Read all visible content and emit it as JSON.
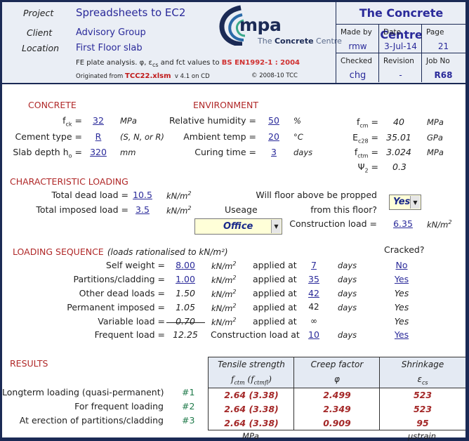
{
  "header": {
    "project_label": "Project",
    "project_value": "Spreadsheets to EC2",
    "client_label": "Client",
    "client_value": "Advisory Group",
    "location_label": "Location",
    "location_value": "First Floor slab",
    "description_prefix": "FE plate analysis. φ, ε",
    "description_sub": "cs",
    "description_mid": " and fct values to ",
    "description_standard": "BS EN1992-1 : 2004",
    "originated_prefix": "Originated from ",
    "originated_file": "TCC22.xlsm",
    "originated_version": "v 4.1 on CD",
    "copyright": "© 2008-10 TCC",
    "logo_text": "mpa",
    "logo_sub_prefix": "The ",
    "logo_sub_bold": "Concrete",
    "logo_sub_suffix": " Centre",
    "org_title": "The Concrete Centre",
    "made_by_label": "Made by",
    "made_by_value": "rmw",
    "date_label": "Date",
    "date_value": "3-Jul-14",
    "page_label": "Page",
    "page_value": "21",
    "checked_label": "Checked",
    "checked_value": "chg",
    "revision_label": "Revision",
    "revision_value": "-",
    "job_no_label": "Job No",
    "job_no_value": "R68"
  },
  "concrete": {
    "title": "CONCRETE",
    "fck_label": "f",
    "fck_sub": "ck",
    "fck_eq": " =",
    "fck_value": "32",
    "fck_unit": "MPa",
    "cement_label": "Cement type =",
    "cement_value": "R",
    "cement_hint": "(S, N, or R)",
    "depth_label": "Slab depth h",
    "depth_sub": "o",
    "depth_eq": " =",
    "depth_value": "320",
    "depth_unit": "mm"
  },
  "environment": {
    "title": "ENVIRONMENT",
    "rh_label": "Relative humidity =",
    "rh_value": "50",
    "rh_unit": "%",
    "temp_label": "Ambient temp =",
    "temp_value": "20",
    "temp_unit": "°C",
    "curing_label": "Curing time =",
    "curing_value": "3",
    "curing_unit": "days"
  },
  "properties": {
    "fcm_label": "f",
    "fcm_sub": "cm",
    "fcm_value": "40",
    "fcm_unit": "MPa",
    "ec28_label": "E",
    "ec28_sub": "c28",
    "ec28_value": "35.01",
    "ec28_unit": "GPa",
    "fctm_label": "f",
    "fctm_sub": "ctm",
    "fctm_value": "3.024",
    "fctm_unit": "MPa",
    "psi2_label": "Ψ",
    "psi2_sub": "2",
    "psi2_value": "0.3",
    "eq": " ="
  },
  "characteristic": {
    "title": "CHARACTERISTIC LOADING",
    "dead_label": "Total dead load =",
    "dead_value": "10.5",
    "imposed_label": "Total imposed load =",
    "imposed_value": "3.5",
    "unit_base": "kN/m",
    "unit_sup": "2",
    "useage_label": "Useage",
    "useage_value": "Office",
    "propped_label_1": "Will floor above be propped",
    "propped_label_2": "from this floor?",
    "propped_value": "Yes",
    "construction_label": "Construction load =",
    "construction_value": "6.35",
    "dropdown_arrow": "▼"
  },
  "sequence": {
    "title": "LOADING SEQUENCE",
    "subtitle": "(loads rationalised to kN/m²)",
    "cracked_header": "Cracked?",
    "applied_at": "applied at",
    "days": "days",
    "unit_base": "kN/m",
    "unit_sup": "2",
    "rows": [
      {
        "label": "Self weight =",
        "value": "8.00",
        "value_input": true,
        "age": "7",
        "age_input": true,
        "days": true,
        "cracked": "No",
        "cracked_input": true
      },
      {
        "label": "Partitions/cladding =",
        "value": "1.00",
        "value_input": true,
        "age": "35",
        "age_input": true,
        "days": true,
        "cracked": "Yes",
        "cracked_input": true
      },
      {
        "label": "Other dead loads =",
        "value": "1.50",
        "value_input": false,
        "age": "42",
        "age_input": true,
        "days": true,
        "cracked": "Yes",
        "cracked_input": false
      },
      {
        "label": "Permanent imposed =",
        "value": "1.05",
        "value_input": false,
        "age": "42",
        "age_input": false,
        "days": true,
        "cracked": "Yes",
        "cracked_input": false
      },
      {
        "label": "Variable load =",
        "value": "0.70",
        "value_input": false,
        "age": "∞",
        "age_input": false,
        "days": false,
        "cracked": "Yes",
        "cracked_input": false
      }
    ],
    "frequent_label": "Frequent load =",
    "frequent_value": "12.25",
    "construction_at_label": "Construction load at",
    "construction_age": "10",
    "construction_cracked": "Yes"
  },
  "results": {
    "title": "RESULTS",
    "col1_title": "Tensile strength",
    "col1_symbol": "f",
    "col1_sub": "ctm",
    "col1_paren": " (f",
    "col1_paren_sub": "ctmfl",
    "col1_paren_close": ")",
    "col2_title": "Creep factor",
    "col2_symbol": "φ",
    "col3_title": "Shrinkage",
    "col3_symbol": "ε",
    "col3_sub": "cs",
    "rows": [
      {
        "label": "Longterm loading (quasi-permanent)",
        "id": "#1",
        "tensile": "2.64 (3.38)",
        "creep": "2.499",
        "shrinkage": "523"
      },
      {
        "label": "For frequent loading",
        "id": "#2",
        "tensile": "2.64 (3.38)",
        "creep": "2.349",
        "shrinkage": "523"
      },
      {
        "label": "At erection of partitions/cladding",
        "id": "#3",
        "tensile": "2.64 (3.38)",
        "creep": "0.909",
        "shrinkage": "95"
      }
    ],
    "unit_tensile": "MPa",
    "unit_shrinkage": "μstrain"
  },
  "colors": {
    "frame": "#1b2a55",
    "header_bg": "#eaeef5",
    "input_blue": "#2a2a9a",
    "section_red": "#b02828",
    "result_red": "#a42828",
    "id_green": "#1f7a4a",
    "dropdown_bg": "#ffffd8"
  }
}
